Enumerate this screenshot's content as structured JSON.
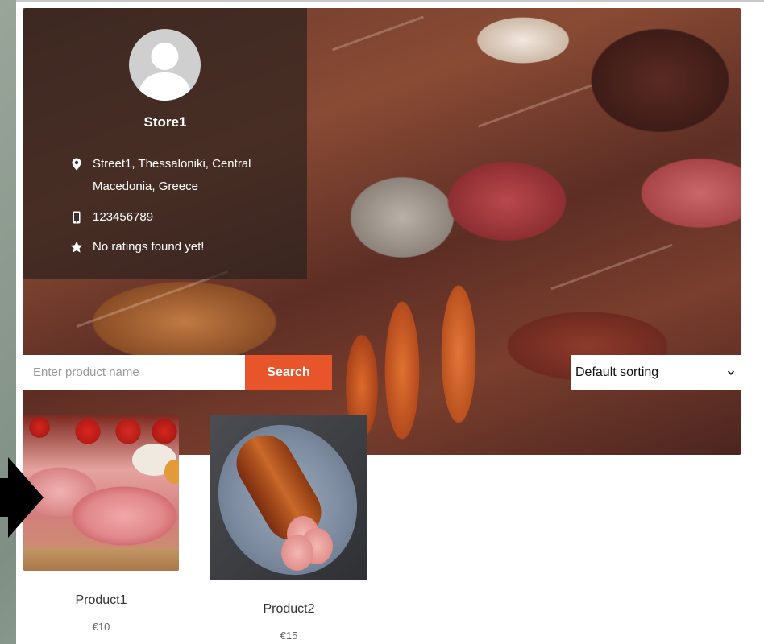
{
  "store": {
    "name": "Store1",
    "address_line1": "Street1, Thessaloniki, Central",
    "address_line2": "Macedonia, Greece",
    "phone": "123456789",
    "rating_text": "No ratings found yet!"
  },
  "search": {
    "placeholder": "Enter product name",
    "button_label": "Search"
  },
  "sorting": {
    "selected": "Default sorting"
  },
  "products": [
    {
      "name": "Product1",
      "price": "€10"
    },
    {
      "name": "Product2",
      "price": "€15"
    }
  ],
  "colors": {
    "accent": "#e8552a",
    "panel_overlay": "rgba(40,32,30,0.68)"
  },
  "icons": {
    "address": "map-pin-icon",
    "phone": "mobile-phone-icon",
    "rating": "star-icon",
    "avatar": "user-avatar-icon",
    "sort": "chevron-down-icon",
    "pointer": "arrow-right-icon"
  }
}
